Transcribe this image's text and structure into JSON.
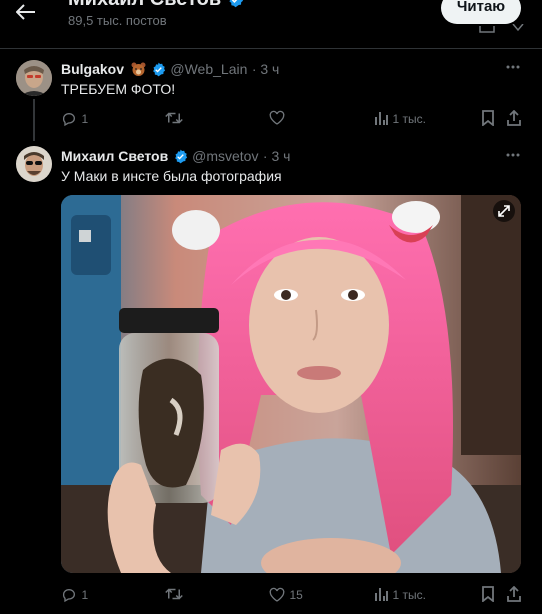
{
  "header": {
    "title": "Михаил Светов",
    "subtitle": "89,5 тыс. постов",
    "follow_label": "Читаю"
  },
  "tweet1": {
    "name": "Bulgakov",
    "handle": "@Web_Lain",
    "time": "· 3 ч",
    "text": "ТРЕБУЕМ ФОТО!",
    "replies": "1",
    "retweets": "",
    "likes": "",
    "views": "1 тыс."
  },
  "tweet2": {
    "name": "Михаил Светов",
    "handle": "@msvetov",
    "time": "· 3 ч",
    "text": "У Маки в инсте была фотография",
    "replies": "1",
    "retweets": "",
    "likes": "15",
    "views": "1 тыс."
  },
  "colors": {
    "background": "#000000",
    "verified": "#1d9bf0",
    "muted": "#71767b",
    "divider": "#2f3336",
    "hair": "#f07aa8"
  },
  "icons": [
    "back-arrow-icon",
    "verified-badge-icon",
    "more-icon",
    "reply-icon",
    "retweet-icon",
    "like-icon",
    "views-icon",
    "bookmark-icon",
    "share-icon",
    "expand-icon",
    "bear-emoji-icon"
  ]
}
